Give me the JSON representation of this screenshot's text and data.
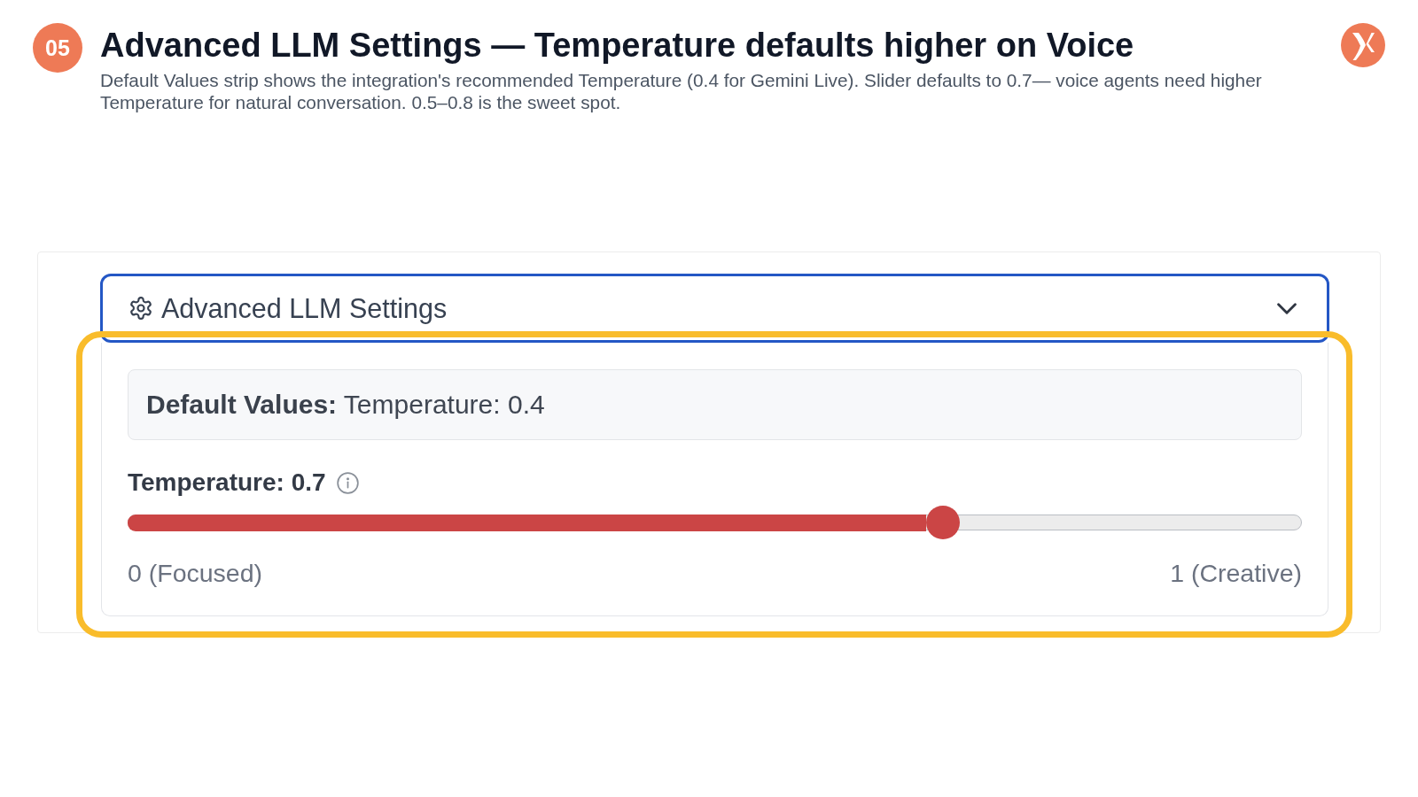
{
  "step_badge": "05",
  "title": "Advanced LLM Settings — Temperature defaults higher on Voice",
  "subtitle": "Default Values strip shows the integration's recommended Temperature (0.4 for Gemini Live). Slider defaults to 0.7— voice agents need higher Temperature for natural conversation. 0.5–0.8 is the sweet spot.",
  "settings": {
    "title": "Advanced LLM Settings",
    "expanded": true,
    "focused": true,
    "defaults_strip": "**Default Values:** Temperature: 0.4",
    "slider": {
      "label": "Temperature: 0.7",
      "level": 0.7,
      "min_label": "0 (Focused)",
      "max_label": "1 (Creative)"
    }
  }
}
